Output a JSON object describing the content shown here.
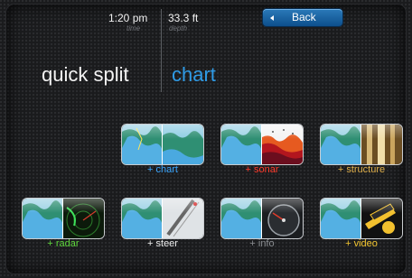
{
  "status": {
    "time": "1:20 pm",
    "time_label": "time",
    "depth": "33.3 ft",
    "depth_label": "depth"
  },
  "back_button": {
    "label": "Back"
  },
  "heading": {
    "title": "quick split",
    "mode": "chart"
  },
  "tiles": [
    {
      "id": "chart",
      "caption": "+ chart",
      "caption_color": "#3aa6ff",
      "icon": "chart-icon"
    },
    {
      "id": "sonar",
      "caption": "+ sonar",
      "caption_color": "#ff3a2a",
      "icon": "sonar-icon"
    },
    {
      "id": "structure",
      "caption": "+ structure",
      "caption_color": "#e1b04a",
      "icon": "structure-icon"
    },
    {
      "id": "radar",
      "caption": "+ radar",
      "caption_color": "#5ed63c",
      "icon": "radar-icon"
    },
    {
      "id": "steer",
      "caption": "+ steer",
      "caption_color": "#eeeeee",
      "icon": "steer-icon"
    },
    {
      "id": "info",
      "caption": "+ info",
      "caption_color": "#8a8d91",
      "icon": "info-icon"
    },
    {
      "id": "video",
      "caption": "+ video",
      "caption_color": "#f3c630",
      "icon": "video-icon"
    }
  ]
}
